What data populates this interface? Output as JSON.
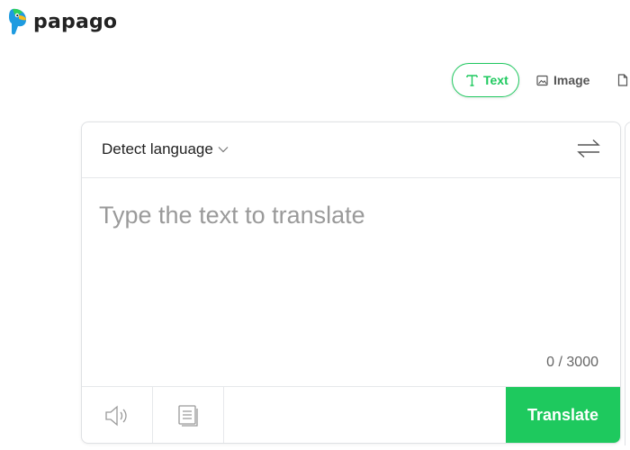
{
  "app": {
    "name": "papago"
  },
  "tabs": [
    {
      "label": "Text",
      "icon": "text-t-icon",
      "active": true
    },
    {
      "label": "Image",
      "icon": "image-icon",
      "active": false
    },
    {
      "label": "",
      "icon": "document-icon",
      "active": false
    }
  ],
  "translator": {
    "source_language": "Detect language",
    "input_value": "",
    "input_placeholder": "Type the text to translate",
    "char_count": "0 / 3000",
    "translate_label": "Translate"
  },
  "colors": {
    "brand_green": "#1ec95e",
    "logo_blue": "#1e9be0",
    "logo_green": "#2fd05a"
  },
  "icons": {
    "swap": "swap-arrows-icon",
    "speaker": "speaker-icon",
    "notes": "notes-icon",
    "dropdown": "chevron-down-icon"
  }
}
